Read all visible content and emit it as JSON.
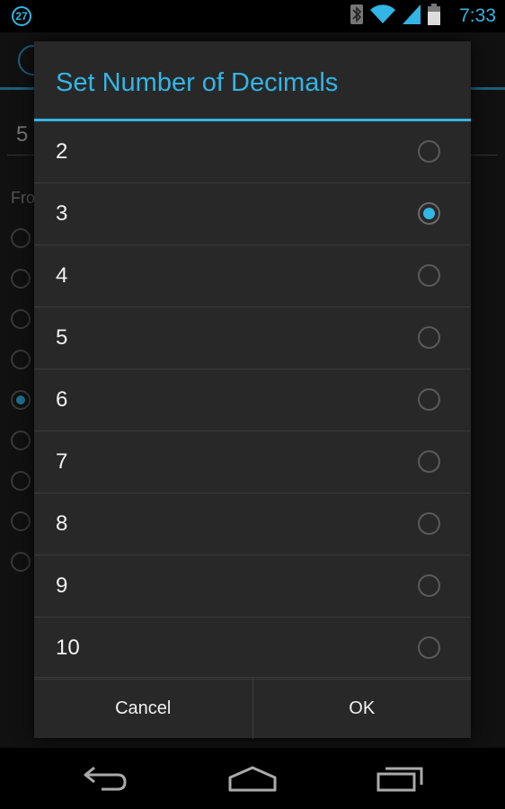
{
  "status_bar": {
    "notification_badge": "27",
    "time": "7:33",
    "icons": [
      "bluetooth-icon",
      "wifi-icon",
      "signal-icon",
      "battery-icon"
    ],
    "accent_color": "#33b5e5"
  },
  "background": {
    "input_value": "5",
    "section_label": "Fro"
  },
  "dialog": {
    "title": "Set Number of Decimals",
    "options": [
      {
        "label": "2",
        "checked": false
      },
      {
        "label": "3",
        "checked": true
      },
      {
        "label": "4",
        "checked": false
      },
      {
        "label": "5",
        "checked": false
      },
      {
        "label": "6",
        "checked": false
      },
      {
        "label": "7",
        "checked": false
      },
      {
        "label": "8",
        "checked": false
      },
      {
        "label": "9",
        "checked": false
      },
      {
        "label": "10",
        "checked": false
      }
    ],
    "cancel_label": "Cancel",
    "ok_label": "OK"
  },
  "nav_bar": {
    "icons": [
      "back-icon",
      "home-icon",
      "recent-apps-icon"
    ]
  }
}
